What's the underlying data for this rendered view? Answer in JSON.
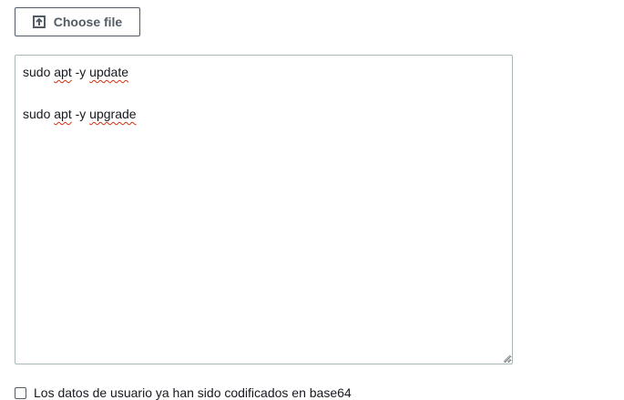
{
  "file_upload": {
    "button_label": "Choose file",
    "icon": "upload-icon"
  },
  "user_data": {
    "lines": [
      {
        "parts": [
          {
            "t": "sudo "
          },
          {
            "t": "apt",
            "spell": true
          },
          {
            "t": " -y "
          },
          {
            "t": "update",
            "spell": true
          }
        ]
      },
      {
        "parts": []
      },
      {
        "parts": [
          {
            "t": "sudo "
          },
          {
            "t": "apt",
            "spell": true
          },
          {
            "t": " -y "
          },
          {
            "t": "upgrade",
            "spell": true
          }
        ]
      }
    ]
  },
  "base64_option": {
    "label": "Los datos de usuario ya han sido codificados en base64",
    "checked": false
  },
  "colors": {
    "button_border": "#545b64",
    "textarea_border": "#aab7b8",
    "spellcheck_underline": "#d13212"
  }
}
